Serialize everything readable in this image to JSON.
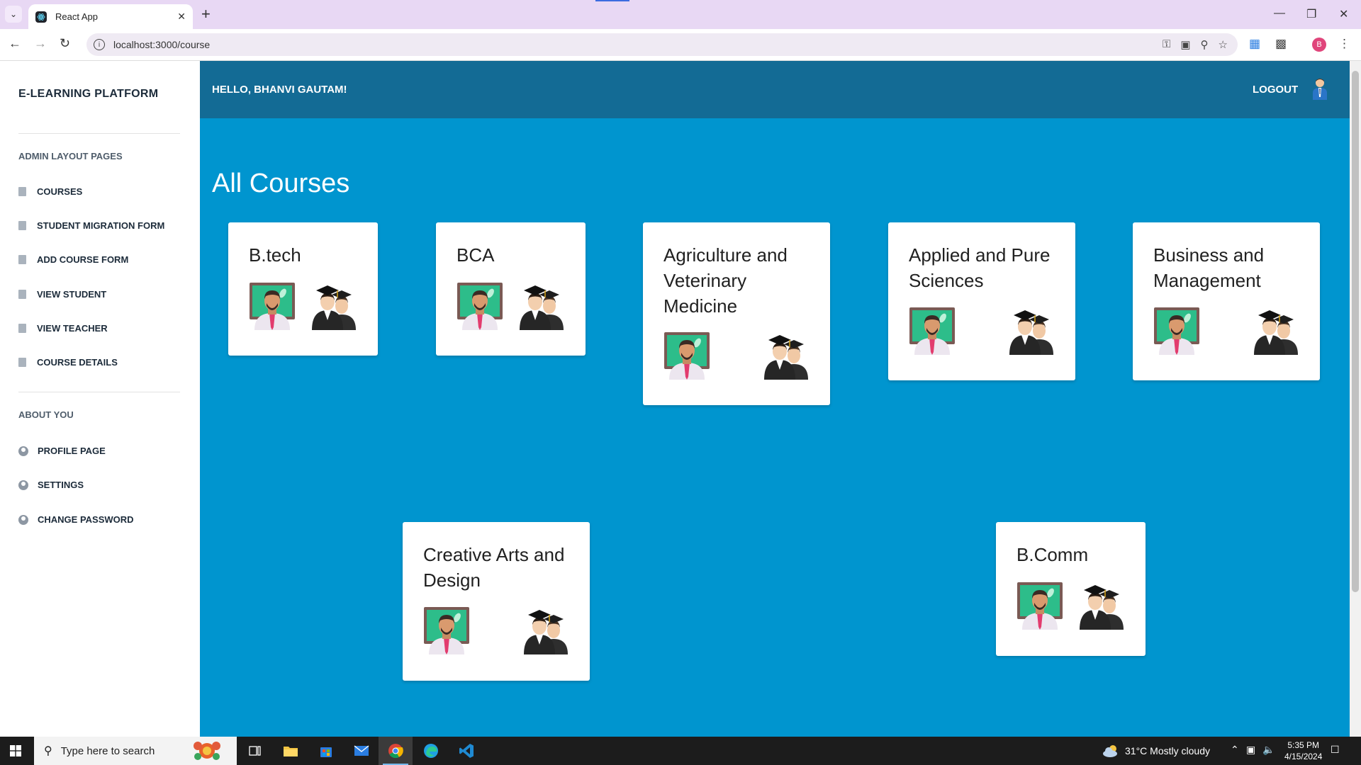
{
  "browser": {
    "tab_title": "React App",
    "url": "localhost:3000/course",
    "profile_initial": "B"
  },
  "sidebar": {
    "brand": "E-LEARNING PLATFORM",
    "section_admin": "ADMIN LAYOUT PAGES",
    "admin_items": [
      {
        "label": "COURSES"
      },
      {
        "label": "STUDENT MIGRATION FORM"
      },
      {
        "label": "ADD COURSE FORM"
      },
      {
        "label": "VIEW STUDENT"
      },
      {
        "label": "VIEW TEACHER"
      },
      {
        "label": "COURSE DETAILS"
      }
    ],
    "section_about": "ABOUT YOU",
    "about_items": [
      {
        "label": "PROFILE PAGE"
      },
      {
        "label": "SETTINGS"
      },
      {
        "label": "CHANGE PASSWORD"
      }
    ]
  },
  "header": {
    "greeting": "HELLO, BHANVI GAUTAM!",
    "logout": "LOGOUT"
  },
  "main": {
    "title": "All Courses",
    "courses": [
      {
        "name": "B.tech"
      },
      {
        "name": "BCA"
      },
      {
        "name": "Agriculture and Veterinary Medicine"
      },
      {
        "name": "Applied and Pure Sciences"
      },
      {
        "name": "Business and Management"
      },
      {
        "name": "Creative Arts and Design"
      },
      {
        "name": "B.Comm"
      }
    ]
  },
  "taskbar": {
    "search_placeholder": "Type here to search",
    "weather": "31°C  Mostly cloudy",
    "time": "5:35 PM",
    "date": "4/15/2024"
  },
  "colors": {
    "main_bg": "#0095cf",
    "topbar_bg": "#136b95",
    "sidebar_text": "#1c2b3a"
  }
}
